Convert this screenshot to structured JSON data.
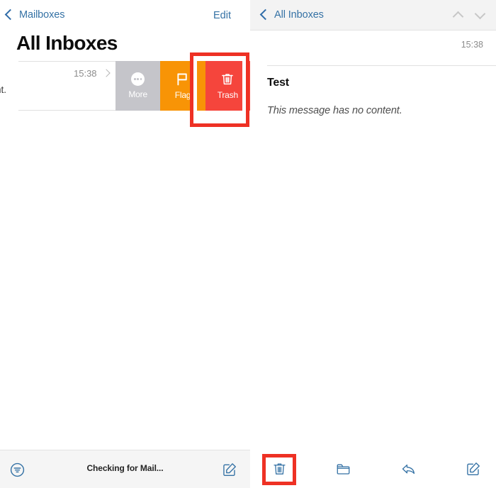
{
  "left_panel": {
    "nav": {
      "back_label": "Mailboxes",
      "back_icon": "chevron-left-icon",
      "edit_label": "Edit"
    },
    "title": "All Inboxes",
    "mail_row": {
      "preview_remnant": "nt.",
      "time": "15:38",
      "disclosure_icon": "chevron-right-icon",
      "swipe_actions": [
        {
          "label": "More",
          "icon": "more-dots-icon",
          "color": "#C5C5CA"
        },
        {
          "label": "Flag",
          "icon": "flag-icon",
          "color": "#F89406"
        },
        {
          "label": "Trash",
          "icon": "trash-icon",
          "color": "#F5453C"
        }
      ]
    },
    "toolbar": {
      "filter_icon": "filter-icon",
      "status": "Checking for Mail...",
      "compose_icon": "compose-icon"
    }
  },
  "right_panel": {
    "nav": {
      "back_label": "All Inboxes",
      "back_icon": "chevron-left-icon",
      "prev_icon": "chevron-up-icon",
      "next_icon": "chevron-down-icon"
    },
    "message": {
      "time": "15:38",
      "subject": "Test",
      "body": "This message has no content."
    },
    "toolbar": {
      "trash_icon": "trash-icon",
      "folder_icon": "folder-icon",
      "reply_icon": "reply-icon",
      "compose_icon": "compose-icon"
    }
  },
  "annotations": {
    "highlight_color": "#EE3124",
    "highlight_targets": [
      "swipe-trash-button",
      "toolbar-trash-button"
    ]
  },
  "theme": {
    "accent_blue": "#3572A5",
    "toolbar_bg": "#F5F5F5",
    "navbar_bg": "#F3F3F3",
    "trash_red": "#F5453C",
    "flag_orange": "#F89406",
    "more_gray": "#C5C5CA"
  }
}
